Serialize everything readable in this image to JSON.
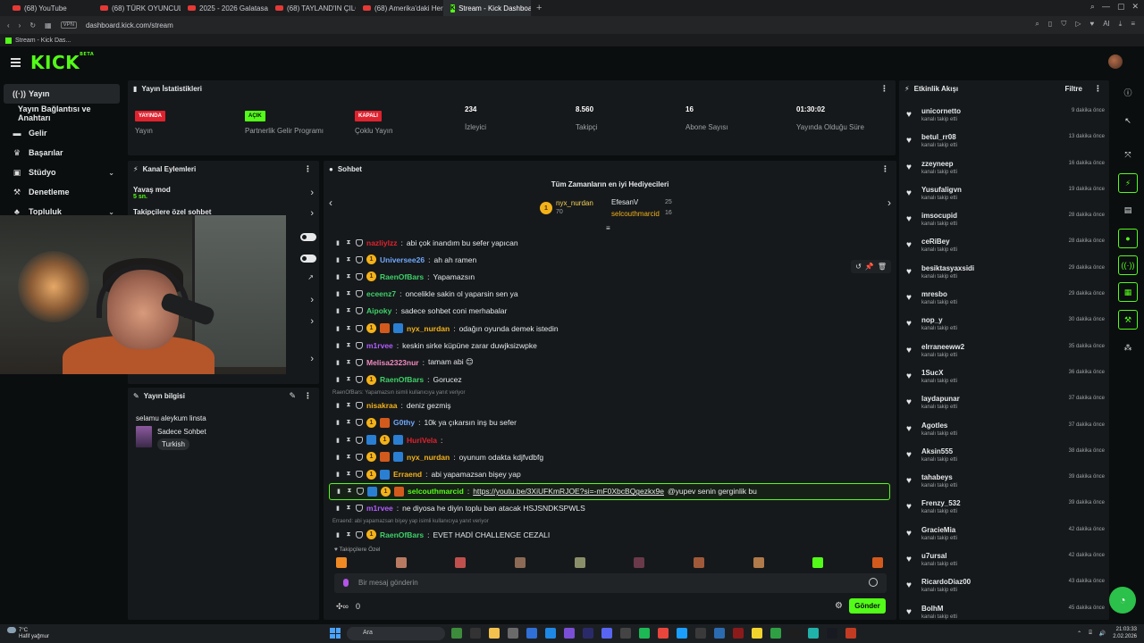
{
  "browser": {
    "tabs": [
      {
        "label": "(68) YouTube",
        "icon": "youtube-icon"
      },
      {
        "label": "(68) TÜRK OYUNCULAR",
        "icon": "youtube-icon"
      },
      {
        "label": "2025 - 2026 Galatasaray",
        "icon": "youtube-icon"
      },
      {
        "label": "(68) TAYLAND'IN ÇILGIN",
        "icon": "youtube-icon"
      },
      {
        "label": "(68) Amerika'daki Herkes",
        "icon": "youtube-icon"
      },
      {
        "label": "Stream - Kick Dashboard",
        "icon": "kick-icon"
      }
    ],
    "vpn": "VPN",
    "url": "dashboard.kick.com/stream",
    "ai_label": "AI",
    "bookmark": "Stream - Kick Das..."
  },
  "header": {
    "logo": "KICK",
    "beta": "BETA"
  },
  "sidebar": {
    "items": [
      {
        "label": "Yayın",
        "icon": "broadcast-icon"
      },
      {
        "label": "Yayın Bağlantısı ve Anahtarı",
        "icon": ""
      },
      {
        "label": "Gelir",
        "icon": "money-icon"
      },
      {
        "label": "Başarılar",
        "icon": "trophy-icon"
      },
      {
        "label": "Stüdyo",
        "icon": "studio-icon"
      },
      {
        "label": "Denetleme",
        "icon": "moderation-icon"
      },
      {
        "label": "Topluluk",
        "icon": "community-icon"
      }
    ]
  },
  "stats": {
    "title": "Yayın İstatistikleri",
    "items": [
      {
        "badge": "YAYINDA",
        "label": "Yayın"
      },
      {
        "badge": "AÇIK",
        "label": "Partnerlik Gelir Programı"
      },
      {
        "badge": "KAPALI",
        "label": "Çoklu Yayın"
      },
      {
        "value": "234",
        "label": "İzleyici"
      },
      {
        "value": "8.560",
        "label": "Takipçi"
      },
      {
        "value": "16",
        "label": "Abone Sayısı"
      },
      {
        "value": "01:30:02",
        "label": "Yayında Olduğu Süre"
      }
    ],
    "colors": {
      "red": "#e0222f",
      "green": "#53fc18"
    }
  },
  "kanal": {
    "title": "Kanal Eylemleri",
    "slow_mode": "Yavaş mod",
    "slow_mode_value": "5 sn.",
    "followers_only": "Takipçilere özel sohbet"
  },
  "yayin_bilgisi": {
    "title": "Yayın bilgisi",
    "stream_title": "selamu aleykum linsta",
    "category": "Sadece Sohbet",
    "tag": "Turkish"
  },
  "chat": {
    "title": "Sohbet",
    "gifters_title": "Tüm Zamanların en iyi Hediyecileri",
    "gifters": [
      {
        "name": "nyx_nurdan",
        "count": "70",
        "rank": "1"
      },
      {
        "name": "EfesanV",
        "count": "25"
      },
      {
        "name": "selcouthmarcid",
        "count": "16"
      }
    ],
    "messages": [
      {
        "user": "nazliylzz",
        "color": "#e0222f",
        "text": "abi çok inandım bu sefer yapıcan",
        "badges": []
      },
      {
        "user": "Universee26",
        "color": "#6fa8ff",
        "text": "ah ah ramen",
        "badges": [
          "num"
        ]
      },
      {
        "user": "RaenOfBars",
        "color": "#3ed06a",
        "text": "Yapamazsın",
        "badges": [
          "num"
        ]
      },
      {
        "user": "eceenz7",
        "color": "#3ed06a",
        "text": "oncelikle sakin ol yaparsin sen ya",
        "badges": []
      },
      {
        "user": "Aipoky",
        "color": "#3ed06a",
        "text": "sadece sohbet coni merhabalar",
        "badges": []
      },
      {
        "user": "nyx_nurdan",
        "color": "#f4b21a",
        "text": "odağın oyunda demek istedin",
        "badges": [
          "num",
          "sub",
          "gift"
        ]
      },
      {
        "user": "m1rvee",
        "color": "#b05cff",
        "text": "keskin sirke küpüne zarar duwjksizwpke",
        "badges": []
      },
      {
        "user": "Melisa2323nur",
        "color": "#f08ac0",
        "text": "tamam abi 😊",
        "badges": []
      },
      {
        "user": "RaenOfBars",
        "color": "#3ed06a",
        "text": "Gorucez",
        "badges": [
          "num"
        ]
      },
      {
        "reply": "RaenOfBars: Yapamazsın isimli kullanıcıya yanıt veriyor"
      },
      {
        "user": "nisakraa",
        "color": "#f4b21a",
        "text": "deniz gezmiş",
        "badges": []
      },
      {
        "user": "G0thy",
        "color": "#6fa8ff",
        "text": "10k ya çıkarsın inş bu sefer",
        "badges": [
          "num",
          "sub"
        ]
      },
      {
        "user": "HuriVela",
        "color": "#e0222f",
        "text": "",
        "badges": [
          "gift",
          "num",
          "gift"
        ]
      },
      {
        "user": "nyx_nurdan",
        "color": "#f4b21a",
        "text": "oyunum odakta kdjfvdbfg",
        "badges": [
          "num",
          "sub",
          "gift"
        ]
      },
      {
        "user": "Erraend",
        "color": "#f4b21a",
        "text": "abi yapamazsan bişey yap",
        "badges": [
          "num",
          "gift"
        ]
      },
      {
        "user": "selcouthmarcid",
        "color": "#53fc18",
        "text": "https://youtu.be/3XiUFKmRJOE?si=-mF0XbcBQgezkx9e",
        "text2": "@yupev senin gerginlik bu",
        "badges": [
          "gift",
          "num",
          "sub"
        ],
        "highlight": true
      },
      {
        "user": "m1rvee",
        "color": "#b05cff",
        "text": "ne diyosa he diyin toplu ban atacak HSJSNDKSPWLS",
        "badges": []
      },
      {
        "reply": "Erraend: abi yapamazsan bişey yap isimli kullanıcıya yanıt veriyor"
      },
      {
        "user": "RaenOfBars",
        "color": "#3ed06a",
        "text": "EVET HADİ CHALLENGE CEZALI",
        "badges": [
          "num"
        ]
      }
    ],
    "followers_only_label": "Takipçilere Özel",
    "input_placeholder": "Bir mesaj gönderin",
    "count": "0",
    "send": "Gönder"
  },
  "activity": {
    "title": "Etkinlik Akışı",
    "filter": "Filtre",
    "desc": "kanalı takip etti",
    "items": [
      {
        "user": "unicornetto",
        "time": "9 dakika önce"
      },
      {
        "user": "betul_rr08",
        "time": "13 dakika önce"
      },
      {
        "user": "zzeyneep",
        "time": "16 dakika önce"
      },
      {
        "user": "Yusufaligvn",
        "time": "19 dakika önce"
      },
      {
        "user": "imsocupid",
        "time": "28 dakika önce"
      },
      {
        "user": "ceRiBey",
        "time": "28 dakika önce"
      },
      {
        "user": "besiktasyaxsidi",
        "time": "29 dakika önce"
      },
      {
        "user": "mresbo",
        "time": "29 dakika önce"
      },
      {
        "user": "nop_y",
        "time": "30 dakika önce"
      },
      {
        "user": "elrraneeww2",
        "time": "35 dakika önce"
      },
      {
        "user": "1SucX",
        "time": "36 dakika önce"
      },
      {
        "user": "laydapunar",
        "time": "37 dakika önce"
      },
      {
        "user": "Agotles",
        "time": "37 dakika önce"
      },
      {
        "user": "Aksin555",
        "time": "38 dakika önce"
      },
      {
        "user": "tahabeys",
        "time": "39 dakika önce"
      },
      {
        "user": "Frenzy_532",
        "time": "39 dakika önce"
      },
      {
        "user": "GracieMia",
        "time": "42 dakika önce"
      },
      {
        "user": "u7ursal",
        "time": "42 dakika önce"
      },
      {
        "user": "RicardoDiaz00",
        "time": "43 dakika önce"
      },
      {
        "user": "BolhM",
        "time": "45 dakika önce"
      }
    ]
  },
  "taskbar": {
    "temp": "7°C",
    "weather": "Hafif yağmur",
    "search": "Ara",
    "time": "21:03:33",
    "date": "2.02.2026"
  }
}
